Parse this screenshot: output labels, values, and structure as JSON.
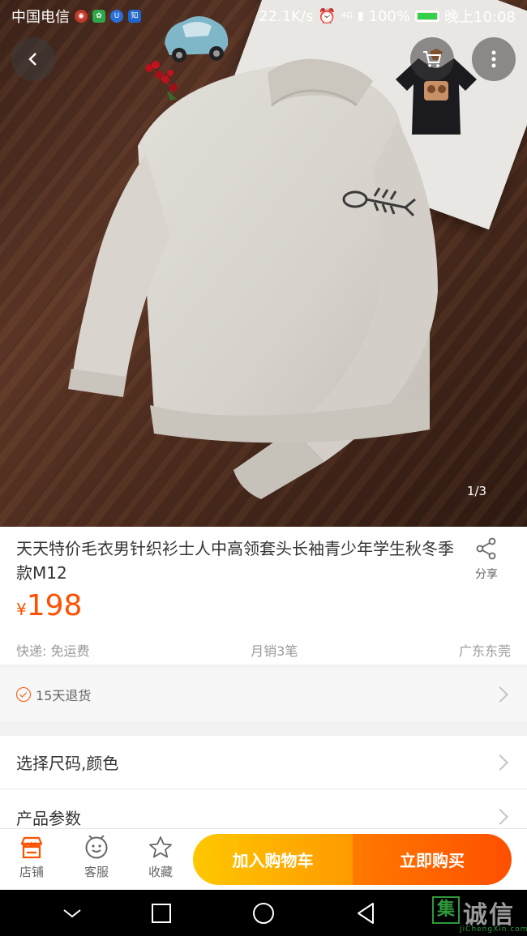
{
  "status_bar": {
    "carrier": "中国电信",
    "app_icon_1": "知",
    "net_speed": "22.1K/s",
    "network": "4G",
    "battery": "100%",
    "time": "晚上10:08"
  },
  "gallery": {
    "indicator": "1/3"
  },
  "product": {
    "title": "天天特价毛衣男针织衫士人中高领套头长袖青少年学生秋冬季款M12",
    "currency": "¥",
    "price": "198",
    "share_label": "分享",
    "shipping": "快递: 免运费",
    "monthly_sales": "月销3笔",
    "location": "广东东莞"
  },
  "guarantee": {
    "label": "15天退货"
  },
  "options": {
    "select_label": "选择尺码,颜色",
    "params_label": "产品参数"
  },
  "action_bar": {
    "store_label": "店铺",
    "service_label": "客服",
    "favorite_label": "收藏",
    "add_to_cart": "加入购物车",
    "buy_now": "立即购买"
  },
  "watermark": {
    "box_char": "集",
    "text": "诚信",
    "sub": "JiChengXin.com"
  },
  "colors": {
    "accent": "#ff5000",
    "cart_button": "#ffb400",
    "buy_button": "#ff6600"
  }
}
